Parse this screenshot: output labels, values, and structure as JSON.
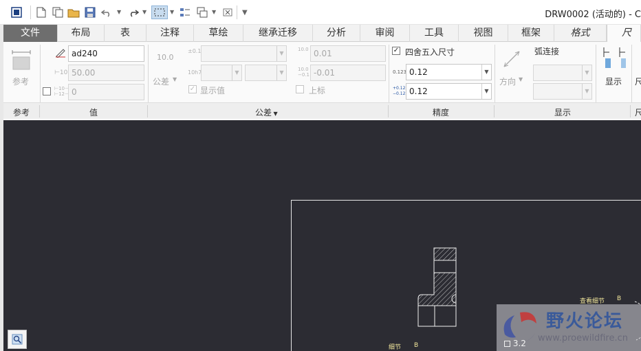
{
  "window": {
    "title": "DRW0002 (活动的) - C"
  },
  "tabs": [
    "文件",
    "布局",
    "表",
    "注释",
    "草绘",
    "继承迁移",
    "分析",
    "审阅",
    "工具",
    "视图",
    "框架",
    "格式",
    "尺寸"
  ],
  "reference": {
    "label": "参考",
    "group": "参考"
  },
  "value": {
    "name": "ad240",
    "nominal": "50.00",
    "override": "0",
    "group": "值"
  },
  "tolerance": {
    "sample": "10.0",
    "mode_label": "公差",
    "upper": "0.01",
    "lower": "-0.01",
    "show_value_label": "显示值",
    "upper_label": "上标",
    "group": "公差",
    "icon_pm": "±0.1",
    "icon_h7": "10h7",
    "icon_updown": "10.0 +0.1 −0.1"
  },
  "precision": {
    "round_label": "四舍五入尺寸",
    "round_checked": true,
    "value1": "0.12",
    "value2": "0.12",
    "icon1": "0.123",
    "icon2": "+0.123 −0.123",
    "group": "精度"
  },
  "display": {
    "direction_label": "方向",
    "arc_label": "弧连接",
    "show_label": "显示",
    "group": "显示"
  },
  "dimension_group_partial": "尺",
  "drawing": {
    "note_view": "查看细节",
    "note_detail": "细节",
    "surface_finish": "3.2",
    "letter_b": "B"
  },
  "watermark": {
    "cn": "野火论坛",
    "url": "www.proewildfire.cn"
  },
  "colors": {
    "canvas": "#2c2c33",
    "file_tab": "#6e6e6e",
    "drawing_line": "#f2f2f2",
    "note": "#f0e59b"
  }
}
